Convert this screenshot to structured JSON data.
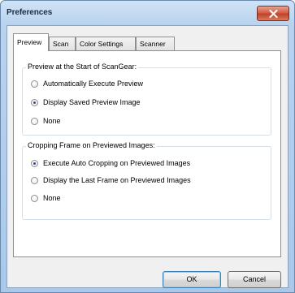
{
  "window": {
    "title": "Preferences"
  },
  "tabs": [
    {
      "label": "Preview",
      "active": true
    },
    {
      "label": "Scan",
      "active": false
    },
    {
      "label": "Color Settings",
      "active": false
    },
    {
      "label": "Scanner",
      "active": false
    }
  ],
  "preview_group": {
    "label": "Preview at the Start of ScanGear:",
    "options": [
      {
        "label": "Automatically Execute Preview",
        "checked": false
      },
      {
        "label": "Display Saved Preview Image",
        "checked": true
      },
      {
        "label": "None",
        "checked": false
      }
    ]
  },
  "cropping_group": {
    "label": "Cropping Frame on Previewed Images:",
    "options": [
      {
        "label": "Execute Auto Cropping on Previewed Images",
        "checked": true
      },
      {
        "label": "Display the Last Frame on Previewed Images",
        "checked": false
      },
      {
        "label": "None",
        "checked": false
      }
    ]
  },
  "buttons": {
    "ok": "OK",
    "cancel": "Cancel"
  },
  "icons": {
    "close": "close-icon"
  }
}
